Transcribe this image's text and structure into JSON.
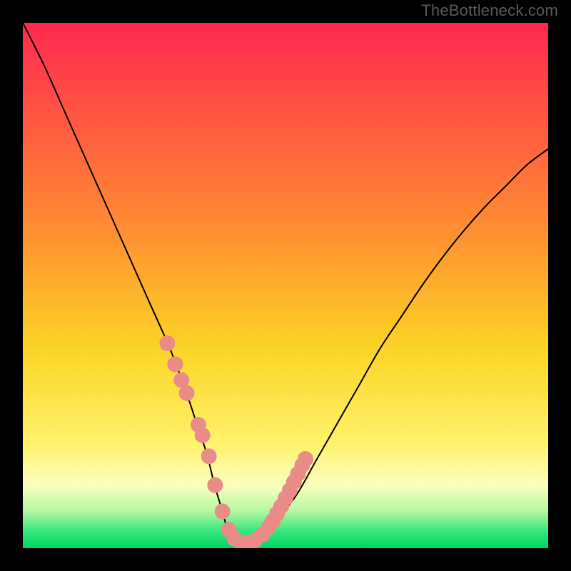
{
  "watermark": {
    "text": "TheBottleneck.com"
  },
  "colors": {
    "black": "#000000",
    "curve": "#000000",
    "marker_fill": "#e98c87",
    "marker_stroke": "#000000",
    "gradient_stops": [
      {
        "offset": 0.0,
        "color": "#ff2850"
      },
      {
        "offset": 0.38,
        "color": "#ff8a32"
      },
      {
        "offset": 0.62,
        "color": "#fbd425"
      },
      {
        "offset": 0.8,
        "color": "#fff26b"
      },
      {
        "offset": 0.88,
        "color": "#fbffbd"
      },
      {
        "offset": 0.93,
        "color": "#b5f7a0"
      },
      {
        "offset": 0.97,
        "color": "#30e67a"
      },
      {
        "offset": 1.0,
        "color": "#00d564"
      }
    ]
  },
  "chart_data": {
    "type": "line",
    "title": "",
    "xlabel": "",
    "ylabel": "",
    "xlim": [
      0,
      100
    ],
    "ylim": [
      0,
      100
    ],
    "series": [
      {
        "name": "bottleneck-curve",
        "x": [
          0,
          4,
          8,
          12,
          16,
          20,
          24,
          28,
          31,
          33,
          35,
          36.5,
          38,
          39,
          40.5,
          42.5,
          45,
          48,
          52,
          56,
          60,
          64,
          68,
          72,
          76,
          80,
          84,
          88,
          92,
          96,
          100
        ],
        "y": [
          100,
          92,
          83,
          74,
          65,
          56,
          47,
          38,
          30,
          24,
          18,
          12,
          7,
          3.5,
          1.5,
          1,
          2,
          5,
          10,
          17,
          24,
          31,
          38,
          44,
          50,
          55.5,
          60.5,
          65,
          69,
          73,
          76
        ]
      }
    ],
    "markers": {
      "name": "highlighted-points",
      "x": [
        27.5,
        29,
        30.2,
        31.2,
        33.4,
        34.2,
        35.4,
        36.6,
        38,
        39.2,
        40.3,
        41.5,
        42.8,
        44.2,
        45.6,
        46.8,
        47.6,
        48.4,
        49.2,
        50,
        50.8,
        51.6,
        52.4,
        53.2,
        53.8
      ],
      "y": [
        39,
        35,
        32,
        29.5,
        23.5,
        21.5,
        17.5,
        12,
        7,
        3.5,
        1.8,
        1.1,
        1,
        1.5,
        2.6,
        4,
        5.2,
        6.6,
        8,
        9.5,
        11,
        12.6,
        14.2,
        15.8,
        17
      ]
    }
  }
}
